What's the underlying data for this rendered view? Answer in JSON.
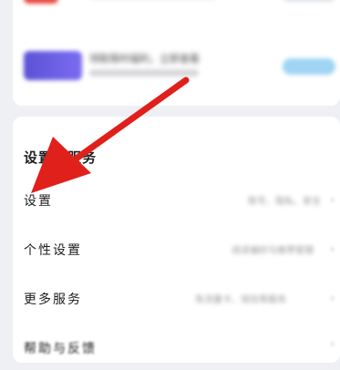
{
  "promos": [
    {
      "title": "",
      "hint": ""
    },
    {
      "title": "领取限时福利，立即查看",
      "button": ""
    }
  ],
  "section": {
    "title": "设置与服务",
    "items": [
      {
        "label": "设置",
        "hint": "账号、隐私、安全"
      },
      {
        "label": "个性设置",
        "hint": "阅读偏好与推荐管理"
      },
      {
        "label": "更多服务",
        "hint": "免流量卡、钱包等服务"
      },
      {
        "label": "帮助与反馈",
        "hint": ""
      }
    ]
  },
  "annotation": {
    "arrow_color": "#e0201b"
  }
}
